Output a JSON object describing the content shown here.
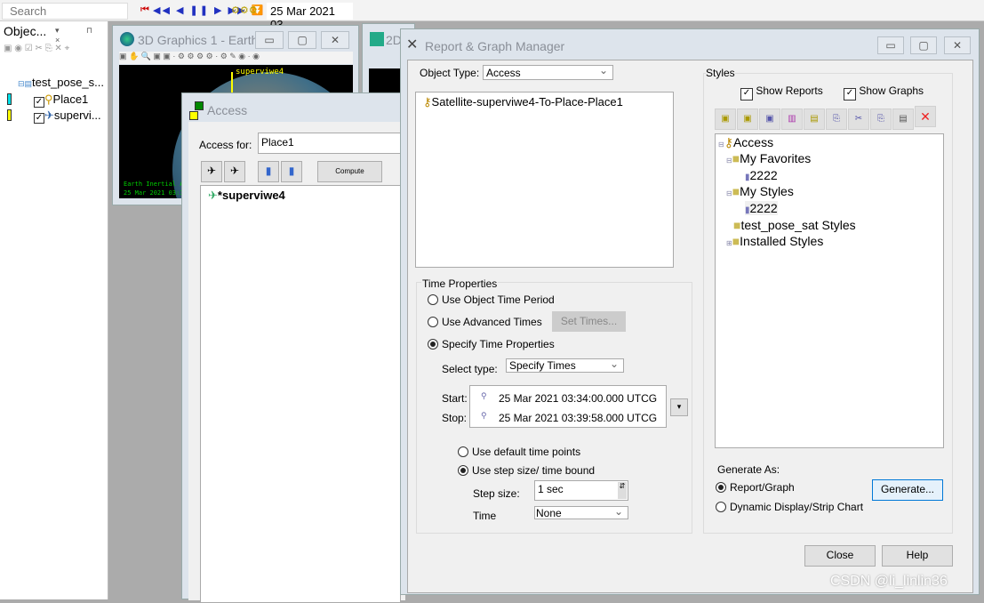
{
  "toolbar": {
    "search_placeholder": "Search",
    "date": "25 Mar 2021 03"
  },
  "object_browser": {
    "title": "Objec...",
    "tree": [
      {
        "label": "test_pose_s..."
      },
      {
        "label": "Place1",
        "color": "#00e0e8"
      },
      {
        "label": "supervi...",
        "color": "#ffff00"
      }
    ]
  },
  "graphics3d": {
    "title": "3D Graphics 1 - Earth",
    "sat_label": "superviwe4",
    "footer1": "Earth Inertial Ax",
    "footer2": "25 Mar 2021 03:34"
  },
  "graphics2d": {
    "title": "2D"
  },
  "access": {
    "title": "Access",
    "access_for_label": "Access for:",
    "access_for_value": "Place1",
    "compute": "Compute",
    "items": [
      "*superviwe4"
    ]
  },
  "rgm": {
    "title": "Report & Graph Manager",
    "object_type_label": "Object Type:",
    "object_type_value": "Access",
    "objects": [
      "Satellite-superviwe4-To-Place-Place1"
    ],
    "time": {
      "title": "Time Properties",
      "opt_object": "Use Object Time Period",
      "opt_advanced": "Use Advanced Times",
      "set_times": "Set Times...",
      "opt_specify": "Specify Time Properties",
      "select_type_label": "Select type:",
      "select_type_value": "Specify Times",
      "start_label": "Start:",
      "start": "25 Mar 2021 03:34:00.000 UTCG",
      "stop_label": "Stop:",
      "stop": "25 Mar 2021 03:39:58.000 UTCG",
      "opt_default": "Use default time points",
      "opt_step": "Use step size/ time bound",
      "step_label": "Step size:",
      "step_value": "1 sec",
      "time_label": "Time",
      "time_value": "None"
    },
    "styles": {
      "title": "Styles",
      "show_reports": "Show Reports",
      "show_graphs": "Show Graphs",
      "tree": [
        "Access",
        "My Favorites",
        "2222",
        "My Styles",
        "2222",
        "test_pose_sat Styles",
        "Installed Styles"
      ]
    },
    "generate": {
      "title": "Generate As:",
      "opt_report": "Report/Graph",
      "opt_dynamic": "Dynamic Display/Strip Chart",
      "button": "Generate..."
    },
    "close": "Close",
    "help": "Help"
  },
  "watermark": "CSDN @li_linlin36"
}
